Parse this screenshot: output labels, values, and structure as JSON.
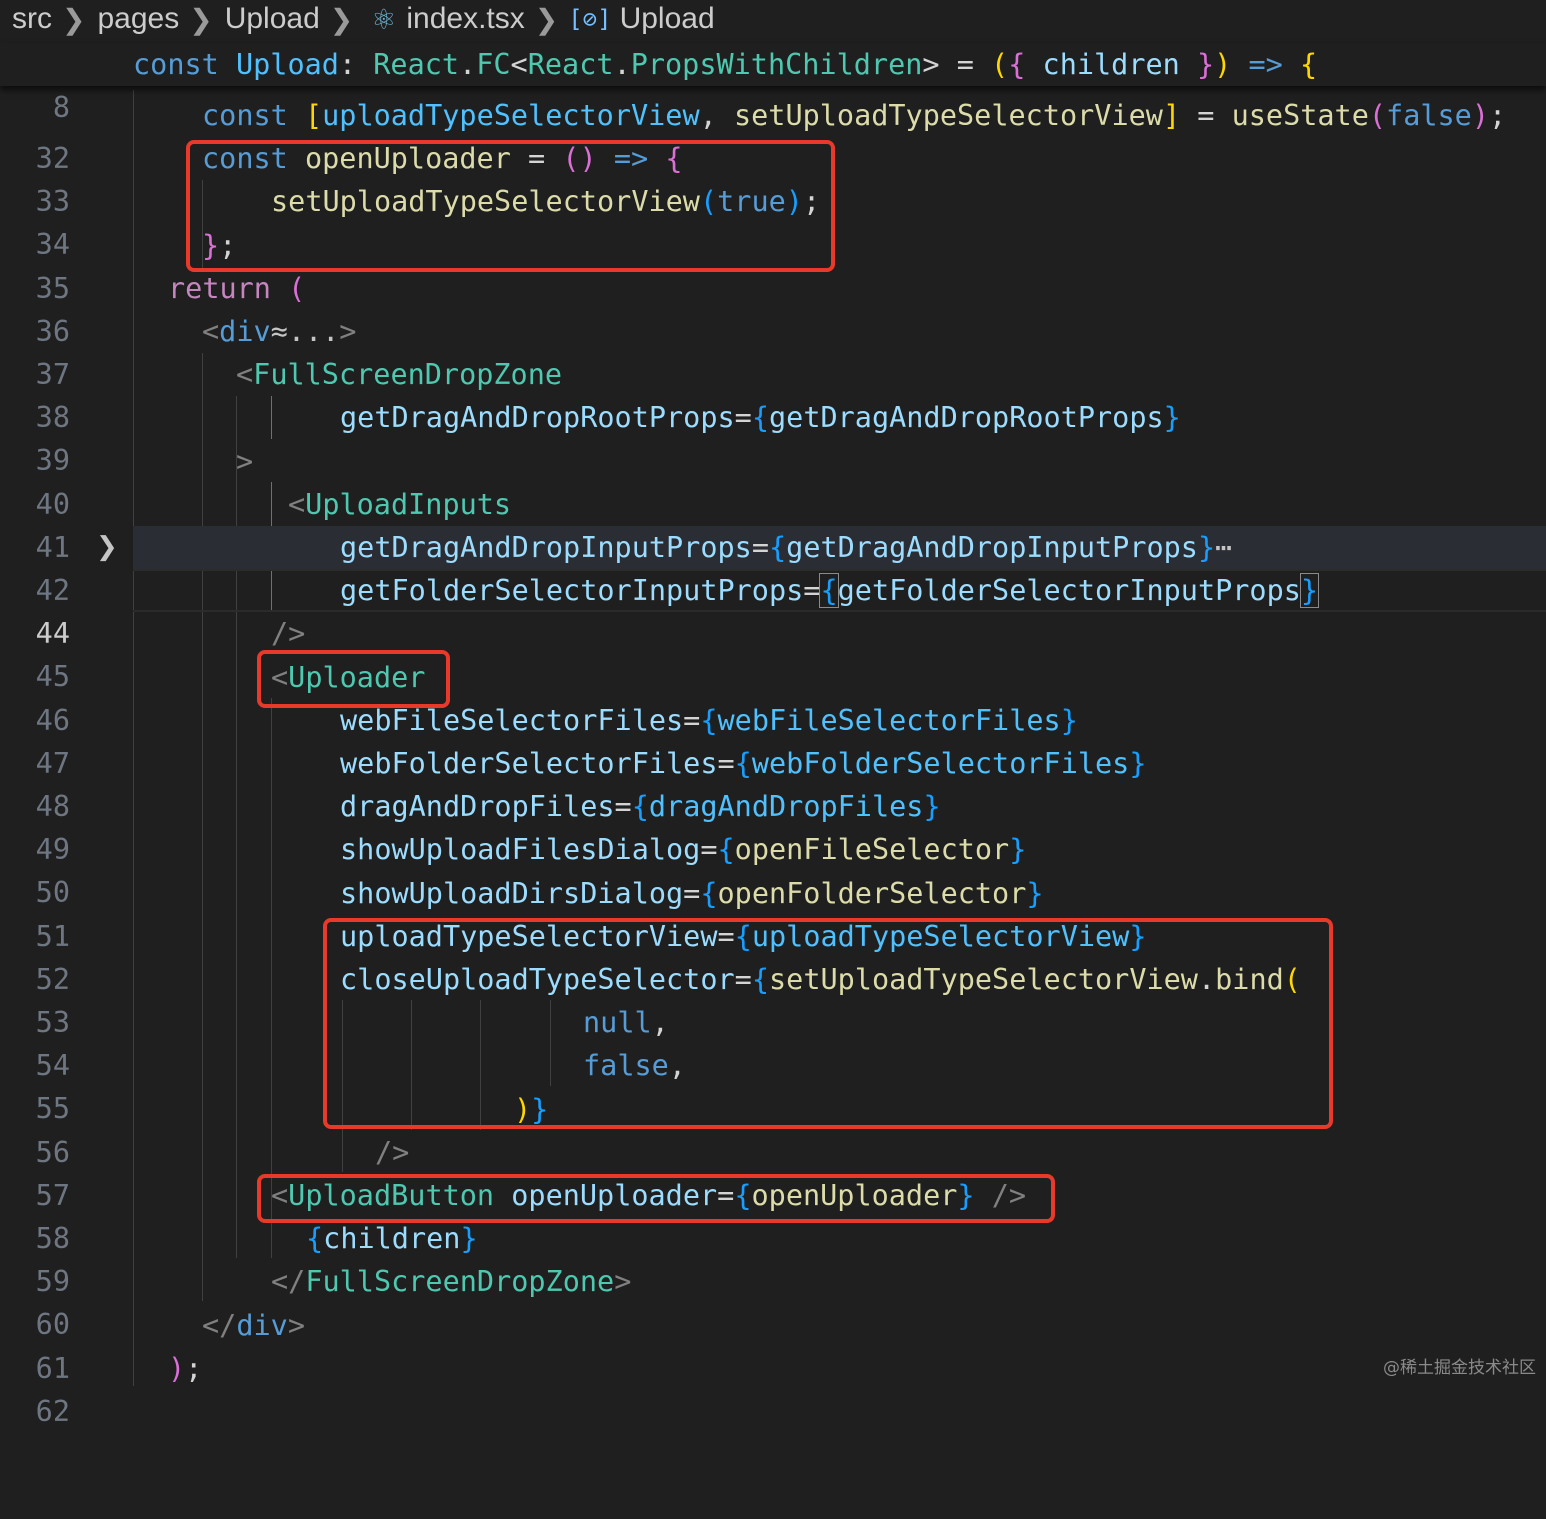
{
  "breadcrumb": {
    "segments": [
      "src",
      "pages",
      "Upload",
      "index.tsx",
      "Upload"
    ],
    "file_icon": "react-icon",
    "symbol_icon": "symbol-variable-icon",
    "separator_icon": "chevron-right-icon"
  },
  "sticky_line": {
    "number": "8",
    "text": "const Upload: React.FC<React.PropsWithChildren> = ({ children }) => {"
  },
  "lines": [
    {
      "n": "32",
      "text": "const [uploadTypeSelectorView, setUploadTypeSelectorView] = useState(false);"
    },
    {
      "n": "33",
      "text": "const openUploader = () => {"
    },
    {
      "n": "34",
      "text": "setUploadTypeSelectorView(true);"
    },
    {
      "n": "35",
      "text": "};"
    },
    {
      "n": "36",
      "text": "return ("
    },
    {
      "n": "37",
      "text": "<div ...>"
    },
    {
      "n": "38",
      "text": "<FullScreenDropZone"
    },
    {
      "n": "39",
      "text": "getDragAndDropRootProps={getDragAndDropRootProps}"
    },
    {
      "n": "40",
      "text": ">"
    },
    {
      "n": "41",
      "text": "<UploadInputs"
    },
    {
      "n": "42",
      "text": "getDragAndDropInputProps={getDragAndDropInputProps}..."
    },
    {
      "n": "44",
      "text": "getFolderSelectorInputProps={getFolderSelectorInputProps}"
    },
    {
      "n": "45",
      "text": "/>"
    },
    {
      "n": "46",
      "text": "<Uploader"
    },
    {
      "n": "47",
      "text": "webFileSelectorFiles={webFileSelectorFiles}"
    },
    {
      "n": "48",
      "text": "webFolderSelectorFiles={webFolderSelectorFiles}"
    },
    {
      "n": "49",
      "text": "dragAndDropFiles={dragAndDropFiles}"
    },
    {
      "n": "50",
      "text": "showUploadFilesDialog={openFileSelector}"
    },
    {
      "n": "51",
      "text": "showUploadDirsDialog={openFolderSelector}"
    },
    {
      "n": "52",
      "text": "uploadTypeSelectorView={uploadTypeSelectorView}"
    },
    {
      "n": "53",
      "text": "closeUploadTypeSelector={setUploadTypeSelectorView.bind("
    },
    {
      "n": "54",
      "text": "null,"
    },
    {
      "n": "55",
      "text": "false,"
    },
    {
      "n": "56",
      "text": ")}"
    },
    {
      "n": "57",
      "text": "/>"
    },
    {
      "n": "58",
      "text": "<UploadButton openUploader={openUploader} />"
    },
    {
      "n": "59",
      "text": "{children}"
    },
    {
      "n": "60",
      "text": "</FullScreenDropZone>"
    },
    {
      "n": "61",
      "text": "</div>"
    },
    {
      "n": "62",
      "text": ");"
    }
  ],
  "active_line": "44",
  "folded_line": "42",
  "annotation_color": "#e8392b",
  "watermark": "@稀土掘金技术社区"
}
